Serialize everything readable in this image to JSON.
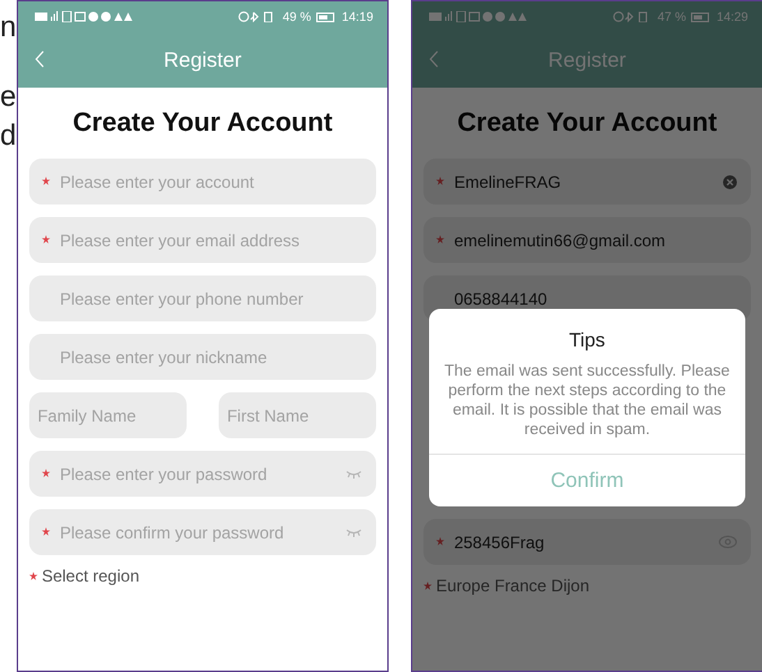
{
  "background_text_fragments": [
    "n",
    "e",
    "d"
  ],
  "screens": [
    {
      "status_bar": {
        "battery": "49 %",
        "time": "14:19"
      },
      "header": {
        "title": "Register"
      },
      "heading": "Create Your Account",
      "dimmed": false,
      "fields": [
        {
          "kind": "single",
          "required": true,
          "placeholder": "Please enter your account"
        },
        {
          "kind": "single",
          "required": true,
          "placeholder": "Please enter your email address"
        },
        {
          "kind": "single",
          "required": false,
          "placeholder": "Please enter your phone number"
        },
        {
          "kind": "single",
          "required": false,
          "placeholder": "Please enter your nickname"
        },
        {
          "kind": "pair",
          "parts": [
            {
              "placeholder": "Family Name"
            },
            {
              "placeholder": "First Name"
            }
          ]
        },
        {
          "kind": "single",
          "required": true,
          "placeholder": "Please enter your password",
          "trailing": {
            "kind": "closed-eye"
          }
        },
        {
          "kind": "single",
          "required": true,
          "placeholder": "Please confirm your password",
          "trailing": {
            "kind": "closed-eye"
          }
        }
      ],
      "region": {
        "required": true,
        "text": "Select region"
      }
    },
    {
      "status_bar": {
        "battery": "47 %",
        "time": "14:29"
      },
      "header": {
        "title": "Register"
      },
      "heading": "Create Your Account",
      "dimmed": true,
      "fields": [
        {
          "kind": "single",
          "required": true,
          "value": "EmelineFRAG",
          "trailing": {
            "kind": "clear"
          }
        },
        {
          "kind": "single",
          "required": true,
          "value": "emelinemutin66@gmail.com"
        },
        {
          "kind": "single",
          "required": false,
          "value": "0658844140"
        },
        {
          "kind": "dialog",
          "title": "Tips",
          "message": "The email was sent successfully. Please perform the next steps according to the email. It is possible that the email was received in spam.",
          "button": "Confirm"
        },
        {
          "kind": "single",
          "required": true,
          "value": "258456Frag",
          "trailing": {
            "kind": "eye"
          }
        }
      ],
      "region": {
        "required": true,
        "text": "Europe France Dijon"
      }
    }
  ]
}
